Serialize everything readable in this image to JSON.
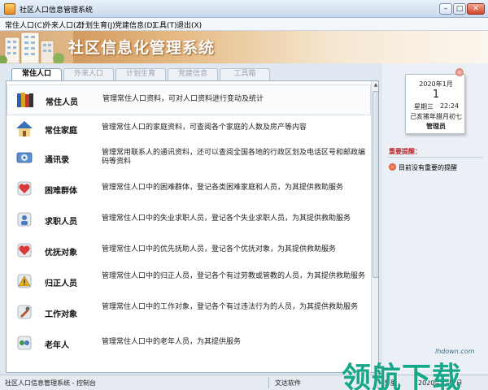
{
  "window": {
    "title": "社区人口信息管理系统",
    "controls": {
      "minimize": "–",
      "maximize": "□",
      "close": "✕"
    }
  },
  "menu": [
    "常住人口(C)",
    "外来人口(Z)",
    "计划生育(J)",
    "党建信息(D)",
    "工具(T)",
    "退出(X)"
  ],
  "banner": {
    "title": "社区信息化管理系统"
  },
  "tabs": [
    {
      "label": "常住人口",
      "active": true
    },
    {
      "label": "外来人口",
      "active": false
    },
    {
      "label": "计划生育",
      "active": false
    },
    {
      "label": "党建信息",
      "active": false
    },
    {
      "label": "工具箱",
      "active": false
    }
  ],
  "items": [
    {
      "label": "常住人员",
      "desc": "管理常住人口资料，可对人口资料进行变动及统计",
      "icon": "books-icon",
      "selected": true
    },
    {
      "label": "常住家庭",
      "desc": "管理常住人口的家庭资料，可查阅各个家庭的人数及房产等内容",
      "icon": "house-icon",
      "selected": false
    },
    {
      "label": "通讯录",
      "desc": "管理常用联系人的通讯资料，还可以查阅全国各地的行政区划及电话区号和邮政编码等资料",
      "icon": "contacts-icon",
      "selected": false
    },
    {
      "label": "困难群体",
      "desc": "管理常住人口中的困难群体，登记各类困难家庭和人员，为其提供救助服务",
      "icon": "heart-icon",
      "selected": false
    },
    {
      "label": "求职人员",
      "desc": "管理常住人口中的失业求职人员，登记各个失业求职人员，为其提供救助服务",
      "icon": "job-seeker-icon",
      "selected": false
    },
    {
      "label": "优抚对象",
      "desc": "管理常住人口中的优先抚助人员，登记各个优抚对象，为其提供救助服务",
      "icon": "heart-icon",
      "selected": false
    },
    {
      "label": "归正人员",
      "desc": "管理常住人口中的归正人员，登记各个有过劳教或管教的人员，为其提供救助服务",
      "icon": "warning-icon",
      "selected": false
    },
    {
      "label": "工作对象",
      "desc": "管理常住人口中的工作对象，登记各个有过违法行为的人员，为其提供救助服务",
      "icon": "work-target-icon",
      "selected": false
    },
    {
      "label": "老年人",
      "desc": "管理常住人口中的老年人员，为其提供服务",
      "icon": "elderly-icon",
      "selected": false
    }
  ],
  "calendar": {
    "month": "2020年1月",
    "day": "1",
    "weekday": "星期三",
    "time": "22:24",
    "lunar": "己亥猪年腊月初七",
    "user": "管理员"
  },
  "reminder": {
    "title": "重要提醒：",
    "text": "目前没有重要的提醒"
  },
  "status": {
    "left": "社区人口信息管理系统 - 控制台",
    "company": "文达软件",
    "user": "管理",
    "date": "2020年1月1日"
  },
  "watermark": {
    "site": "lhdown.com",
    "text": "领航下载"
  },
  "colors": {
    "accent": "#c48346",
    "tab_border": "#8ea2b6",
    "reminder": "#c0252b",
    "watermark": "#18a889"
  }
}
